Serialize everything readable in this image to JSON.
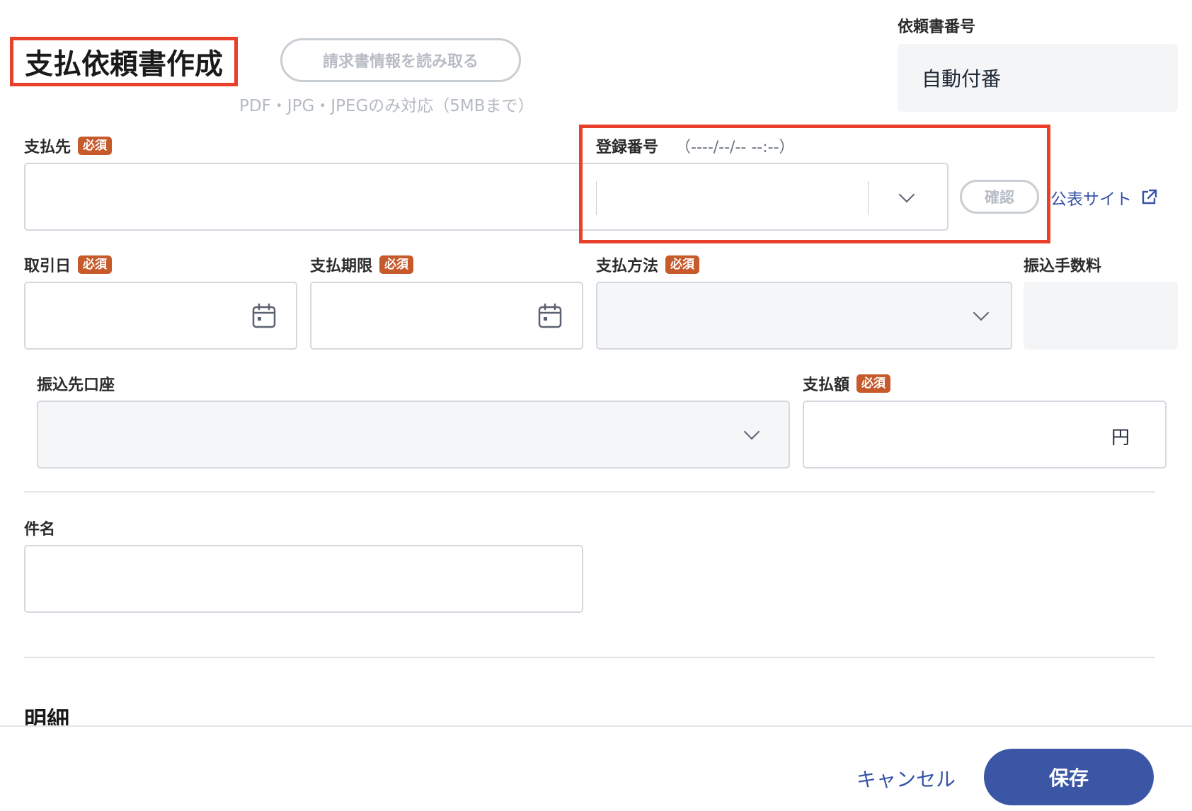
{
  "header": {
    "title": "支払依頼書作成",
    "read_invoice_button": "請求書情報を読み取る",
    "upload_note": "PDF・JPG・JPEGのみ対応（5MBまで）"
  },
  "request_number": {
    "label": "依頼書番号",
    "value": "自動付番"
  },
  "required_badge": "必須",
  "payee": {
    "label": "支払先"
  },
  "registration": {
    "label": "登録番号",
    "hint": "（----/--/-- --:--）",
    "confirm_button": "確認",
    "public_site_link": "公表サイト"
  },
  "transaction_date": {
    "label": "取引日"
  },
  "payment_deadline": {
    "label": "支払期限"
  },
  "payment_method": {
    "label": "支払方法"
  },
  "transfer_fee": {
    "label": "振込手数料"
  },
  "transfer_account": {
    "label": "振込先口座"
  },
  "payment_amount": {
    "label": "支払額",
    "unit": "円"
  },
  "subject": {
    "label": "件名"
  },
  "details": {
    "heading": "明細"
  },
  "footer": {
    "cancel_label": "キャンセル",
    "save_label": "保存"
  },
  "colors": {
    "highlight": "#e8402b",
    "required_badge": "#c65a2a",
    "primary": "#3a56a5",
    "link": "#3554a8"
  }
}
